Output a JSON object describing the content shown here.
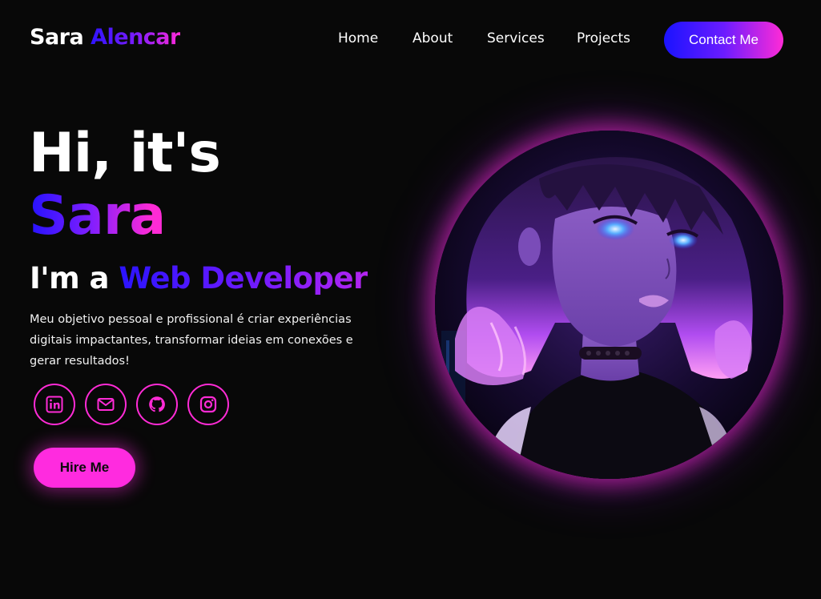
{
  "header": {
    "logo_first": "Sara",
    "logo_last": "Alencar",
    "nav": [
      {
        "label": "Home"
      },
      {
        "label": "About"
      },
      {
        "label": "Services"
      },
      {
        "label": "Projects"
      }
    ],
    "contact_label": "Contact Me"
  },
  "hero": {
    "greeting": "Hi, it's",
    "name": "Sara",
    "role_prefix": "I'm a",
    "role_title": "Web Developer",
    "description": "Meu objetivo pessoal e profissional é criar experiências digitais impactantes, transformar ideias em conexões e gerar resultados!",
    "hire_label": "Hire Me"
  },
  "social": [
    {
      "icon": "linkedin-icon"
    },
    {
      "icon": "mail-icon"
    },
    {
      "icon": "github-icon"
    },
    {
      "icon": "instagram-icon"
    }
  ],
  "colors": {
    "background": "#080808",
    "accent_blue": "#1a13ff",
    "accent_purple": "#7a1cff",
    "accent_pink": "#ff2bd6"
  }
}
